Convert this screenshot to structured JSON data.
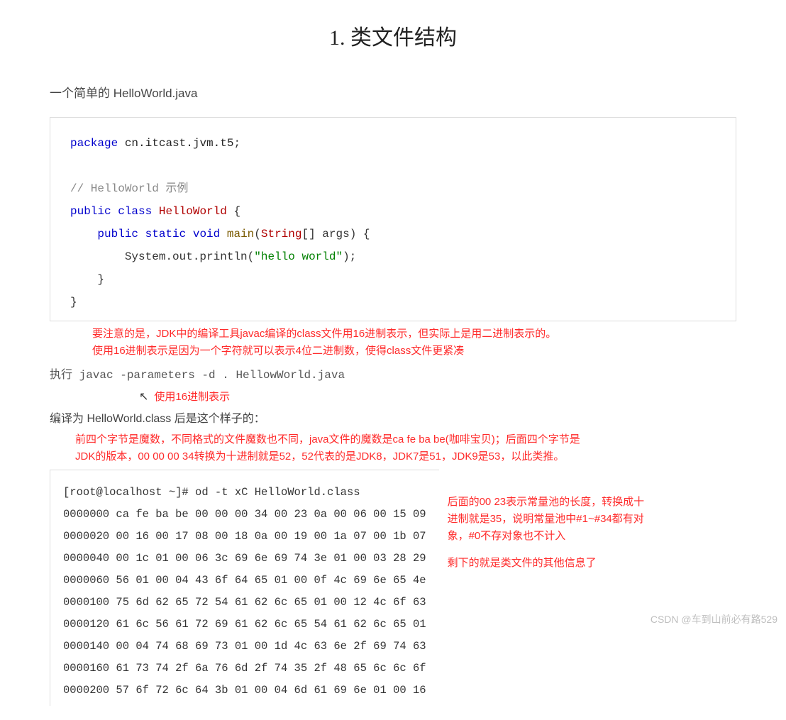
{
  "title": "1. 类文件结构",
  "intro": "一个简单的 HelloWorld.java",
  "code": {
    "pkg_kw": "package",
    "pkg_name": "cn.itcast.jvm.t5",
    "comment": "// HelloWorld 示例",
    "public": "public",
    "class_kw": "class",
    "class_name": "HelloWorld",
    "static": "static",
    "void": "void",
    "main": "main",
    "string": "String",
    "args": "args",
    "sysout": "System.out.println",
    "hello": "\"hello world\""
  },
  "annotations": {
    "note1_a": "要注意的是，JDK中的编译工具javac编译的class文件用16进制表示，但实际上是用二进制表示的。",
    "note1_b": "使用16进制表示是因为一个字符就可以表示4位二进制数，使得class文件更紧凑",
    "note_hex": "使用16进制表示",
    "note2_a": "前四个字节是魔数，不同格式的文件魔数也不同，java文件的魔数是ca fe ba be(咖啡宝贝)；后面四个字节是",
    "note2_b": "JDK的版本，00 00 00 34转换为十进制就是52，52代表的是JDK8，JDK7是51，JDK9是53，以此类推。",
    "side1": "后面的00 23表示常量池的长度，转换成十进制就是35，说明常量池中#1~#34都有对象，#0不存对象也不计入",
    "side2": "剩下的就是类文件的其他信息了"
  },
  "command_line": "执行 javac -parameters -d . HellowWorld.java",
  "result_label": "编译为 HelloWorld.class 后是这个样子的：",
  "hex": {
    "prompt": "[root@localhost ~]# od -t xC HelloWorld.class",
    "rows": [
      "0000000 ca fe ba be 00 00 00 34 00 23 0a 00 06 00 15 09",
      "0000020 00 16 00 17 08 00 18 0a 00 19 00 1a 07 00 1b 07",
      "0000040 00 1c 01 00 06 3c 69 6e 69 74 3e 01 00 03 28 29",
      "0000060 56 01 00 04 43 6f 64 65 01 00 0f 4c 69 6e 65 4e",
      "0000100 75 6d 62 65 72 54 61 62 6c 65 01 00 12 4c 6f 63",
      "0000120 61 6c 56 61 72 69 61 62 6c 65 54 61 62 6c 65 01",
      "0000140 00 04 74 68 69 73 01 00 1d 4c 63 6e 2f 69 74 63",
      "0000160 61 73 74 2f 6a 76 6d 2f 74 35 2f 48 65 6c 6c 6f",
      "0000200 57 6f 72 6c 64 3b 01 00 04 6d 61 69 6e 01 00 16"
    ]
  },
  "watermark": "CSDN @车到山前必有路529"
}
